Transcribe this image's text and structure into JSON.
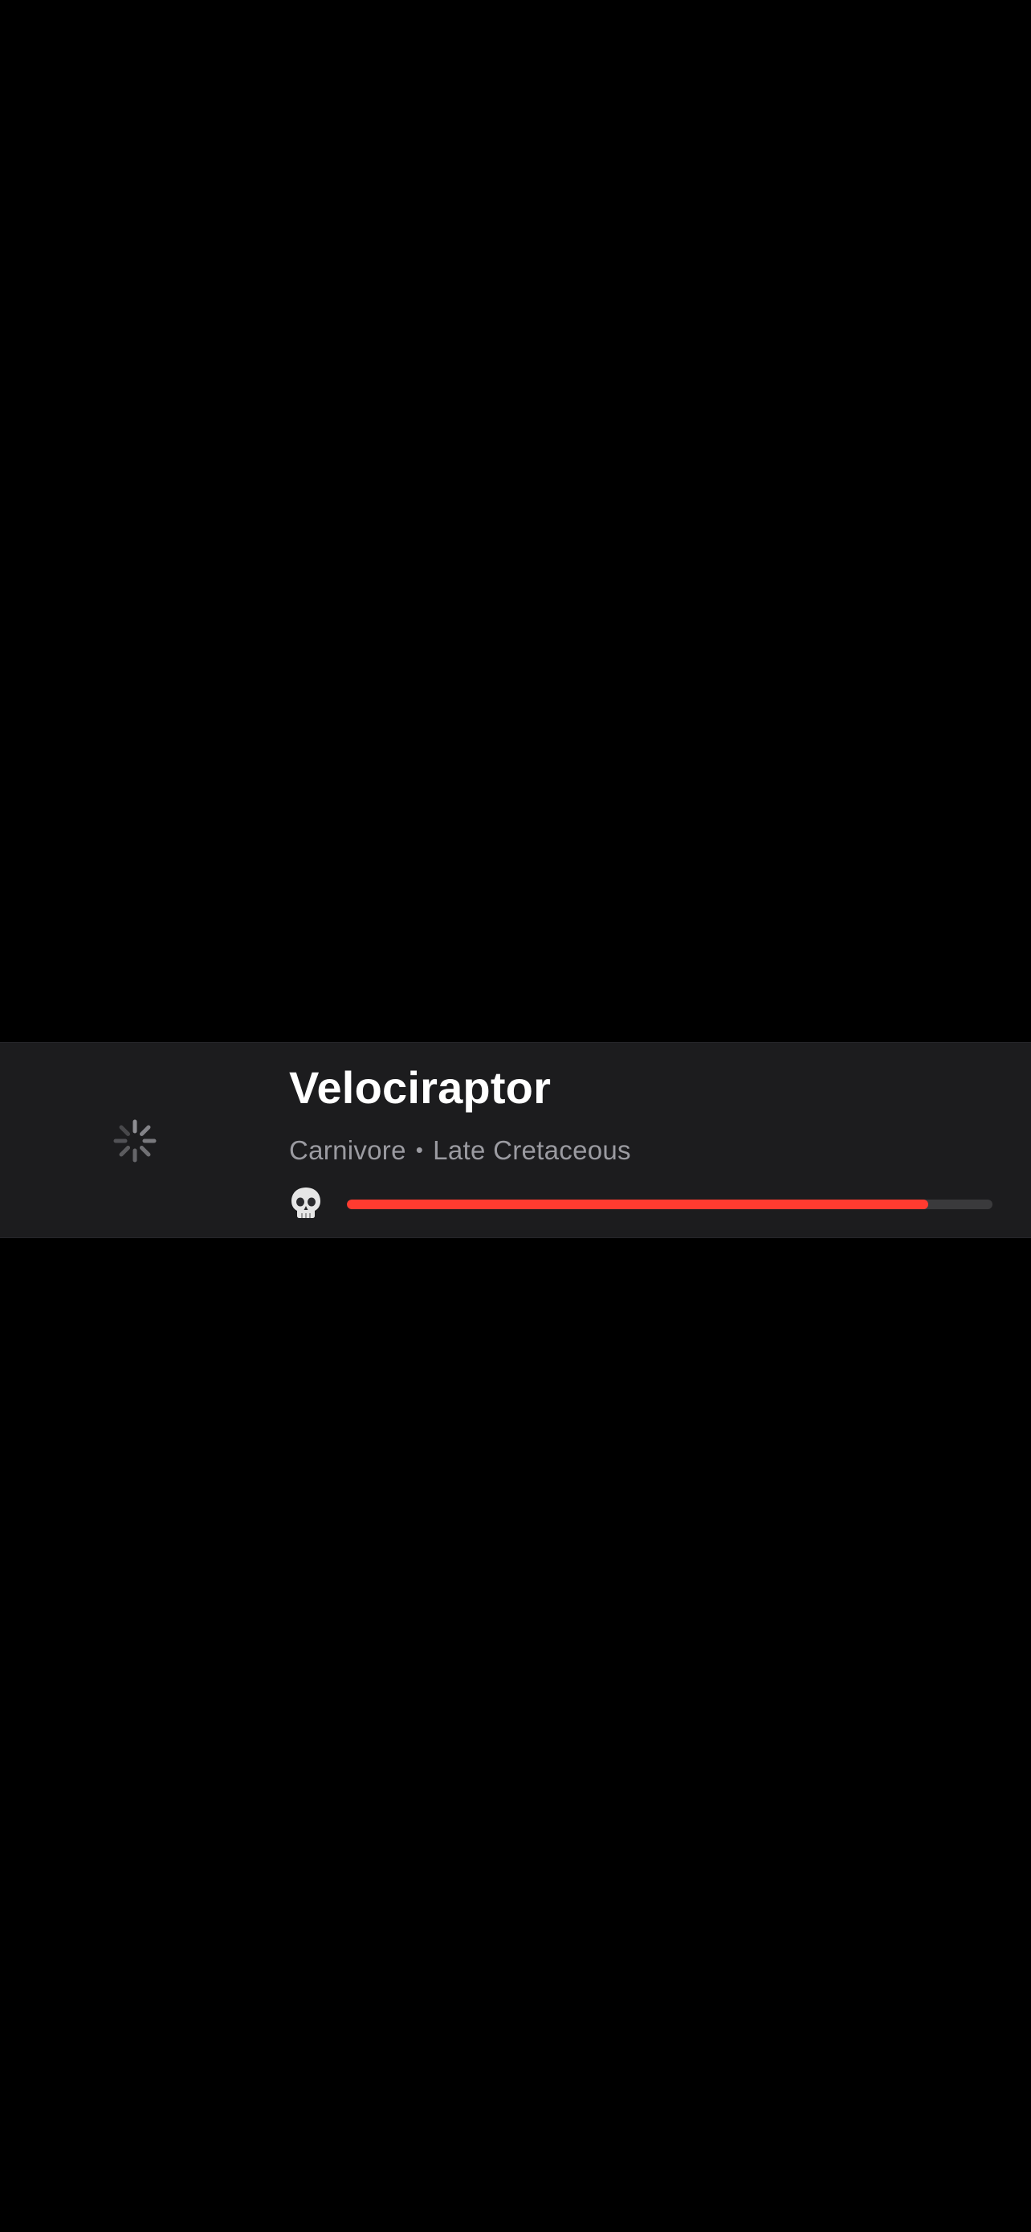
{
  "card": {
    "title": "Velociraptor",
    "diet": "Carnivore",
    "separator": "•",
    "period": "Late Cretaceous",
    "thumbnail_icon": "loading-spinner-icon",
    "threat_icon": "skull-icon",
    "threat_level": 0.9,
    "threat_color": "#ff3b30"
  }
}
